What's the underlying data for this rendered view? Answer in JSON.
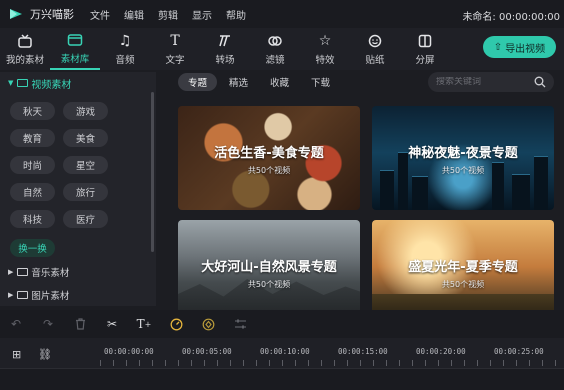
{
  "app": {
    "title": "万兴喵影",
    "project_label": "未命名: 00:00:00:00"
  },
  "menu": [
    "文件",
    "编辑",
    "剪辑",
    "显示",
    "帮助"
  ],
  "toolbar": {
    "tools": [
      {
        "label": "我的素材",
        "icon": "media-box-icon"
      },
      {
        "label": "素材库",
        "icon": "folder-icon"
      },
      {
        "label": "音频",
        "icon": "music-note-icon"
      },
      {
        "label": "文字",
        "icon": "text-t-icon"
      },
      {
        "label": "转场",
        "icon": "transition-icon"
      },
      {
        "label": "滤镜",
        "icon": "filter-icon"
      },
      {
        "label": "特效",
        "icon": "effects-star-icon"
      },
      {
        "label": "贴纸",
        "icon": "sticker-face-icon"
      },
      {
        "label": "分屏",
        "icon": "split-screen-icon"
      }
    ],
    "active_index": 1,
    "export_label": "导出视频"
  },
  "sidebar": {
    "section_title": "视频素材",
    "chips": [
      "秋天",
      "游戏",
      "教育",
      "美食",
      "时尚",
      "星空",
      "自然",
      "旅行",
      "科技",
      "医疗"
    ],
    "switch_label": "换一换",
    "subsections": [
      "音乐素材",
      "图片素材"
    ]
  },
  "main": {
    "tabs": [
      "专题",
      "精选",
      "收藏",
      "下载"
    ],
    "active_tab": 0,
    "search_placeholder": "搜索关键词",
    "cards": [
      {
        "title": "活色生香-美食专题",
        "count": "共50个视频"
      },
      {
        "title": "神秘夜魅-夜景专题",
        "count": "共50个视频"
      },
      {
        "title": "大好河山-自然风景专题",
        "count": "共50个视频"
      },
      {
        "title": "盛夏光年-夏季专题",
        "count": "共50个视频"
      }
    ]
  },
  "timeline": {
    "labels": [
      "00:00:00:00",
      "00:00:05:00",
      "00:00:10:00",
      "00:00:15:00",
      "00:00:20:00",
      "00:00:25:00"
    ]
  },
  "colors": {
    "accent": "#38d3b5",
    "export_bg": "#2fc9ac",
    "background": "#1c1d22"
  }
}
